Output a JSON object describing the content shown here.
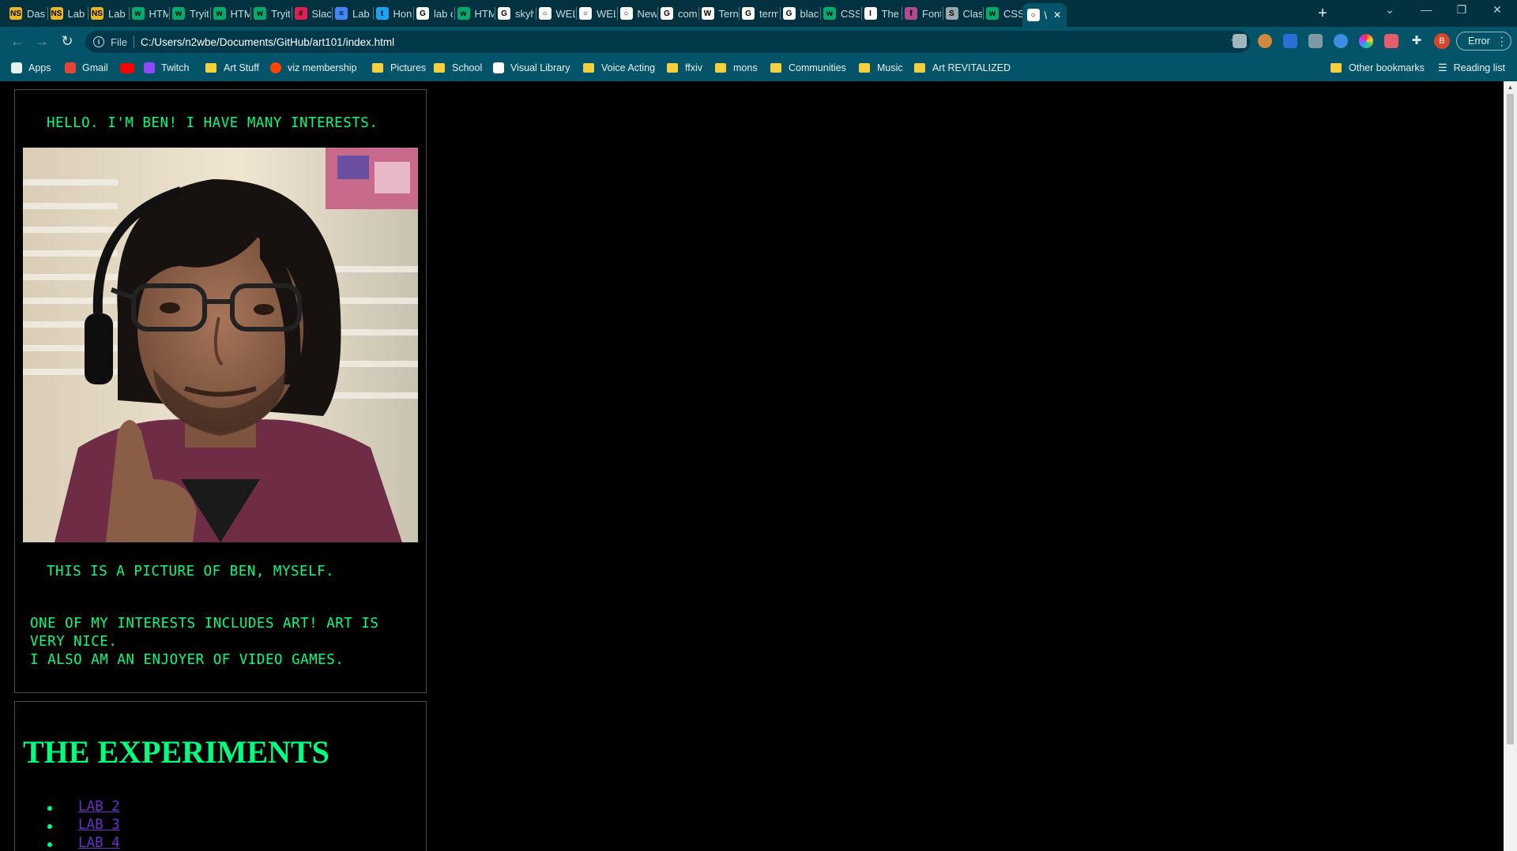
{
  "browser": {
    "tabs": [
      {
        "label": "Dasl",
        "fav_color": "#e8b523",
        "fav_glyph": "NS"
      },
      {
        "label": "Lab",
        "fav_color": "#e8b523",
        "fav_glyph": "NS"
      },
      {
        "label": "Lab",
        "fav_color": "#e8b523",
        "fav_glyph": "NS"
      },
      {
        "label": "HTM",
        "fav_color": "#04aa6d",
        "fav_glyph": "w"
      },
      {
        "label": "Tryit",
        "fav_color": "#04aa6d",
        "fav_glyph": "w"
      },
      {
        "label": "HTM",
        "fav_color": "#04aa6d",
        "fav_glyph": "w"
      },
      {
        "label": "Tryit",
        "fav_color": "#04aa6d",
        "fav_glyph": "w"
      },
      {
        "label": "Slacl",
        "fav_color": "#e01e5a",
        "fav_glyph": "#"
      },
      {
        "label": "Lab",
        "fav_color": "#4285f4",
        "fav_glyph": "≡"
      },
      {
        "label": "Hon",
        "fav_color": "#1da1f2",
        "fav_glyph": "t"
      },
      {
        "label": "lab c",
        "fav_color": "#ffffff",
        "fav_glyph": "G"
      },
      {
        "label": "HTM",
        "fav_color": "#04aa6d",
        "fav_glyph": "w"
      },
      {
        "label": "skyh",
        "fav_color": "#ffffff",
        "fav_glyph": "G"
      },
      {
        "label": "WEL",
        "fav_color": "#ffffff",
        "fav_glyph": "○"
      },
      {
        "label": "WEL",
        "fav_color": "#ffffff",
        "fav_glyph": "○"
      },
      {
        "label": "New",
        "fav_color": "#ffffff",
        "fav_glyph": "○"
      },
      {
        "label": "com",
        "fav_color": "#ffffff",
        "fav_glyph": "G"
      },
      {
        "label": "Tern",
        "fav_color": "#ffffff",
        "fav_glyph": "W"
      },
      {
        "label": "term",
        "fav_color": "#ffffff",
        "fav_glyph": "G"
      },
      {
        "label": "blac",
        "fav_color": "#ffffff",
        "fav_glyph": "G"
      },
      {
        "label": "CSS",
        "fav_color": "#04aa6d",
        "fav_glyph": "w"
      },
      {
        "label": "The",
        "fav_color": "#ffffff",
        "fav_glyph": "I"
      },
      {
        "label": "Font",
        "fav_color": "#b24a8f",
        "fav_glyph": "f"
      },
      {
        "label": "Clas",
        "fav_color": "#9aa9ad",
        "fav_glyph": "S"
      },
      {
        "label": "CSS",
        "fav_color": "#04aa6d",
        "fav_glyph": "w"
      },
      {
        "label": "\\",
        "fav_color": "#ffffff",
        "fav_glyph": "○"
      }
    ],
    "omnibox": {
      "scheme_label": "File",
      "url": "C:/Users/n2wbe/Documents/GitHub/art101/index.html"
    },
    "profile_initial": "B",
    "error_label": "Error",
    "bookmarks": [
      {
        "label": "Apps",
        "type": "apps"
      },
      {
        "label": "Gmail",
        "type": "gmail"
      },
      {
        "label": "",
        "type": "youtube"
      },
      {
        "label": "Twitch",
        "type": "twitch"
      },
      {
        "label": "Art Stuff",
        "type": "folder"
      },
      {
        "label": "viz membership",
        "type": "reddit"
      },
      {
        "label": "Pictures",
        "type": "folder"
      },
      {
        "label": "School",
        "type": "folder"
      },
      {
        "label": "Visual Library",
        "type": "page"
      },
      {
        "label": "Voice Acting",
        "type": "folder"
      },
      {
        "label": "ffxiv",
        "type": "folder"
      },
      {
        "label": "mons",
        "type": "folder"
      },
      {
        "label": "Communities",
        "type": "folder"
      },
      {
        "label": "Music",
        "type": "folder"
      },
      {
        "label": "Art REVITALIZED",
        "type": "folder"
      }
    ],
    "other_bookmarks": "Other bookmarks",
    "reading_list": "Reading list"
  },
  "page": {
    "intro": "HELLO. I'M BEN! I HAVE MANY INTERESTS.",
    "photo_caption": "THIS IS A PICTURE OF BEN, MYSELF.",
    "interests_line1": "ONE OF MY INTERESTS INCLUDES ART! ART IS",
    "interests_line2": "VERY NICE.",
    "interests_line3": "I ALSO AM AN ENJOYER OF VIDEO GAMES.",
    "experiments_heading": "THE EXPERIMENTS",
    "labs": [
      "LAB 2",
      "LAB 3",
      "LAB 4"
    ]
  },
  "colors": {
    "accent_text": "#00ff7f",
    "link": "#6a2fc9",
    "background": "#000000",
    "chrome": "#035469"
  }
}
